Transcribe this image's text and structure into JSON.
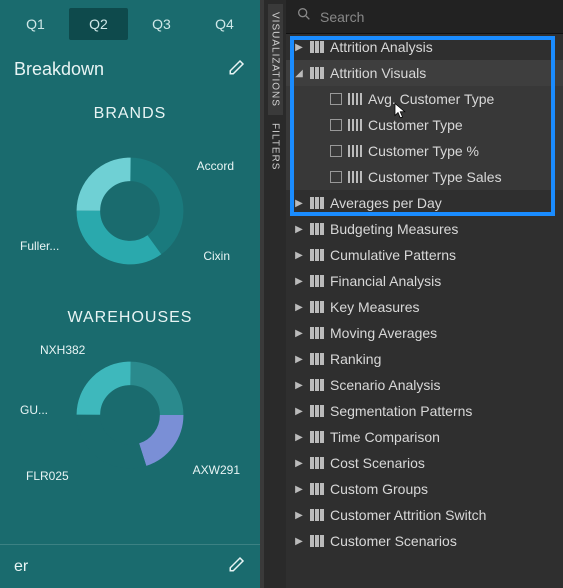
{
  "tabs": [
    "Q1",
    "Q2",
    "Q3",
    "Q4"
  ],
  "active_tab_index": 1,
  "breakdown_label": "Breakdown",
  "sections": {
    "brands": {
      "title": "BRANDS",
      "labels": [
        "Accord",
        "Cixin",
        "Fuller..."
      ]
    },
    "warehouses": {
      "title": "WAREHOUSES",
      "labels": [
        "NXH382",
        "GU...",
        "FLR025",
        "AXW291"
      ]
    }
  },
  "footer_label": "er",
  "vtabs": [
    "VISUALIZATIONS",
    "FILTERS"
  ],
  "search_placeholder": "Search",
  "tree": {
    "items": [
      {
        "label": "Attrition Analysis",
        "expanded": false,
        "icon": "table"
      },
      {
        "label": "Attrition Visuals",
        "expanded": true,
        "icon": "table",
        "selected": true,
        "children": [
          {
            "label": "Avg. Customer Type"
          },
          {
            "label": "Customer Type"
          },
          {
            "label": "Customer Type %"
          },
          {
            "label": "Customer Type Sales"
          }
        ]
      },
      {
        "label": "Averages per Day",
        "expanded": false,
        "icon": "table"
      },
      {
        "label": "Budgeting Measures",
        "expanded": false,
        "icon": "table"
      },
      {
        "label": "Cumulative Patterns",
        "expanded": false,
        "icon": "table"
      },
      {
        "label": "Financial Analysis",
        "expanded": false,
        "icon": "table"
      },
      {
        "label": "Key Measures",
        "expanded": false,
        "icon": "table"
      },
      {
        "label": "Moving Averages",
        "expanded": false,
        "icon": "table"
      },
      {
        "label": "Ranking",
        "expanded": false,
        "icon": "table"
      },
      {
        "label": "Scenario Analysis",
        "expanded": false,
        "icon": "table"
      },
      {
        "label": "Segmentation Patterns",
        "expanded": false,
        "icon": "table"
      },
      {
        "label": "Time Comparison",
        "expanded": false,
        "icon": "table"
      },
      {
        "label": "Cost Scenarios",
        "expanded": false,
        "icon": "grid"
      },
      {
        "label": "Custom Groups",
        "expanded": false,
        "icon": "grid"
      },
      {
        "label": "Customer Attrition Switch",
        "expanded": false,
        "icon": "grid"
      },
      {
        "label": "Customer Scenarios",
        "expanded": false,
        "icon": "grid"
      }
    ]
  },
  "chart_data": [
    {
      "type": "pie",
      "title": "BRANDS",
      "series": [
        {
          "name": "Brands",
          "values": [
            40,
            35,
            25
          ]
        }
      ],
      "categories": [
        "Accord",
        "Cixin",
        "Fuller..."
      ],
      "colors": [
        "#1a7a7d",
        "#2aa9ad",
        "#6fd0d4"
      ]
    },
    {
      "type": "pie",
      "title": "WAREHOUSES",
      "series": [
        {
          "name": "Warehouses",
          "values": [
            25,
            20,
            30,
            25
          ]
        }
      ],
      "categories": [
        "NXH382",
        "GU...",
        "FLR025",
        "AXW291"
      ],
      "colors": [
        "#2a8a8d",
        "#7a8fd6",
        "#1a6b6e",
        "#3eb8bc"
      ]
    }
  ]
}
